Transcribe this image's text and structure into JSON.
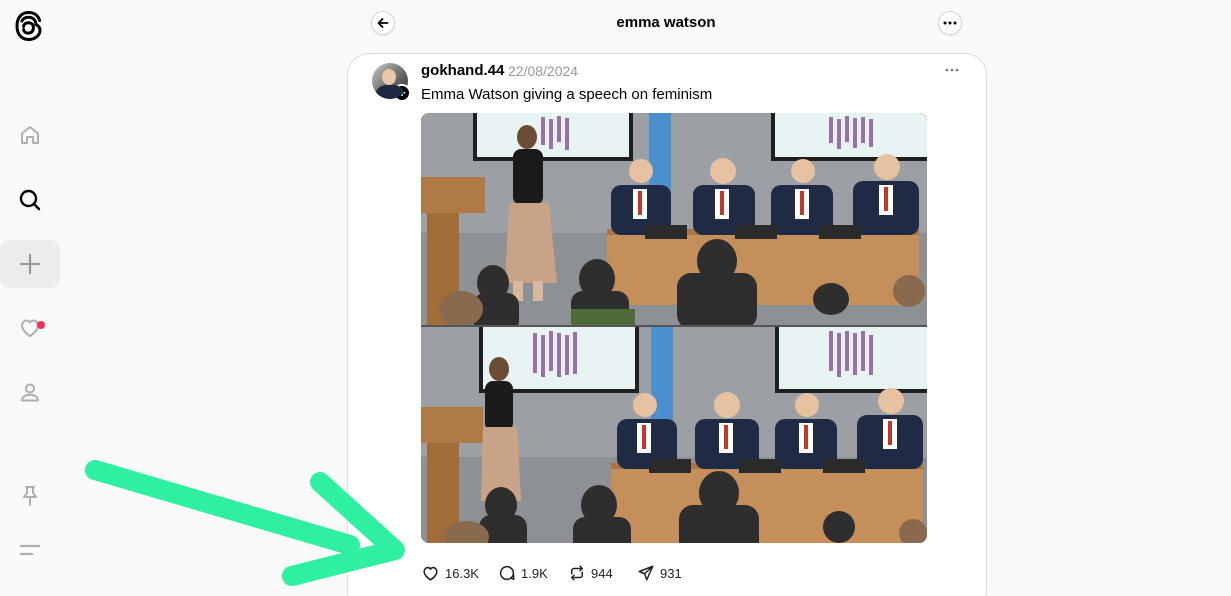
{
  "header": {
    "title": "emma watson"
  },
  "sidebar": {
    "items": [
      {
        "name": "home",
        "icon": "home-icon"
      },
      {
        "name": "search",
        "icon": "search-icon"
      },
      {
        "name": "create",
        "icon": "plus-icon"
      },
      {
        "name": "activity",
        "icon": "heart-icon"
      },
      {
        "name": "profile",
        "icon": "person-icon"
      },
      {
        "name": "pinned",
        "icon": "pin-icon"
      },
      {
        "name": "menu",
        "icon": "menu-icon"
      }
    ],
    "notification_dot_color": "#ff2d55"
  },
  "post": {
    "username": "gokhand.44",
    "date": "22/08/2024",
    "text": "Emma Watson giving a speech on feminism",
    "image_alt": "Two frames of a conference at the UN with a speaker at a podium and panelists at a table",
    "stats": {
      "likes": "16.3K",
      "replies": "1.9K",
      "reposts": "944",
      "shares": "931"
    }
  },
  "annotation": {
    "arrow_color": "#2ff0a0"
  }
}
